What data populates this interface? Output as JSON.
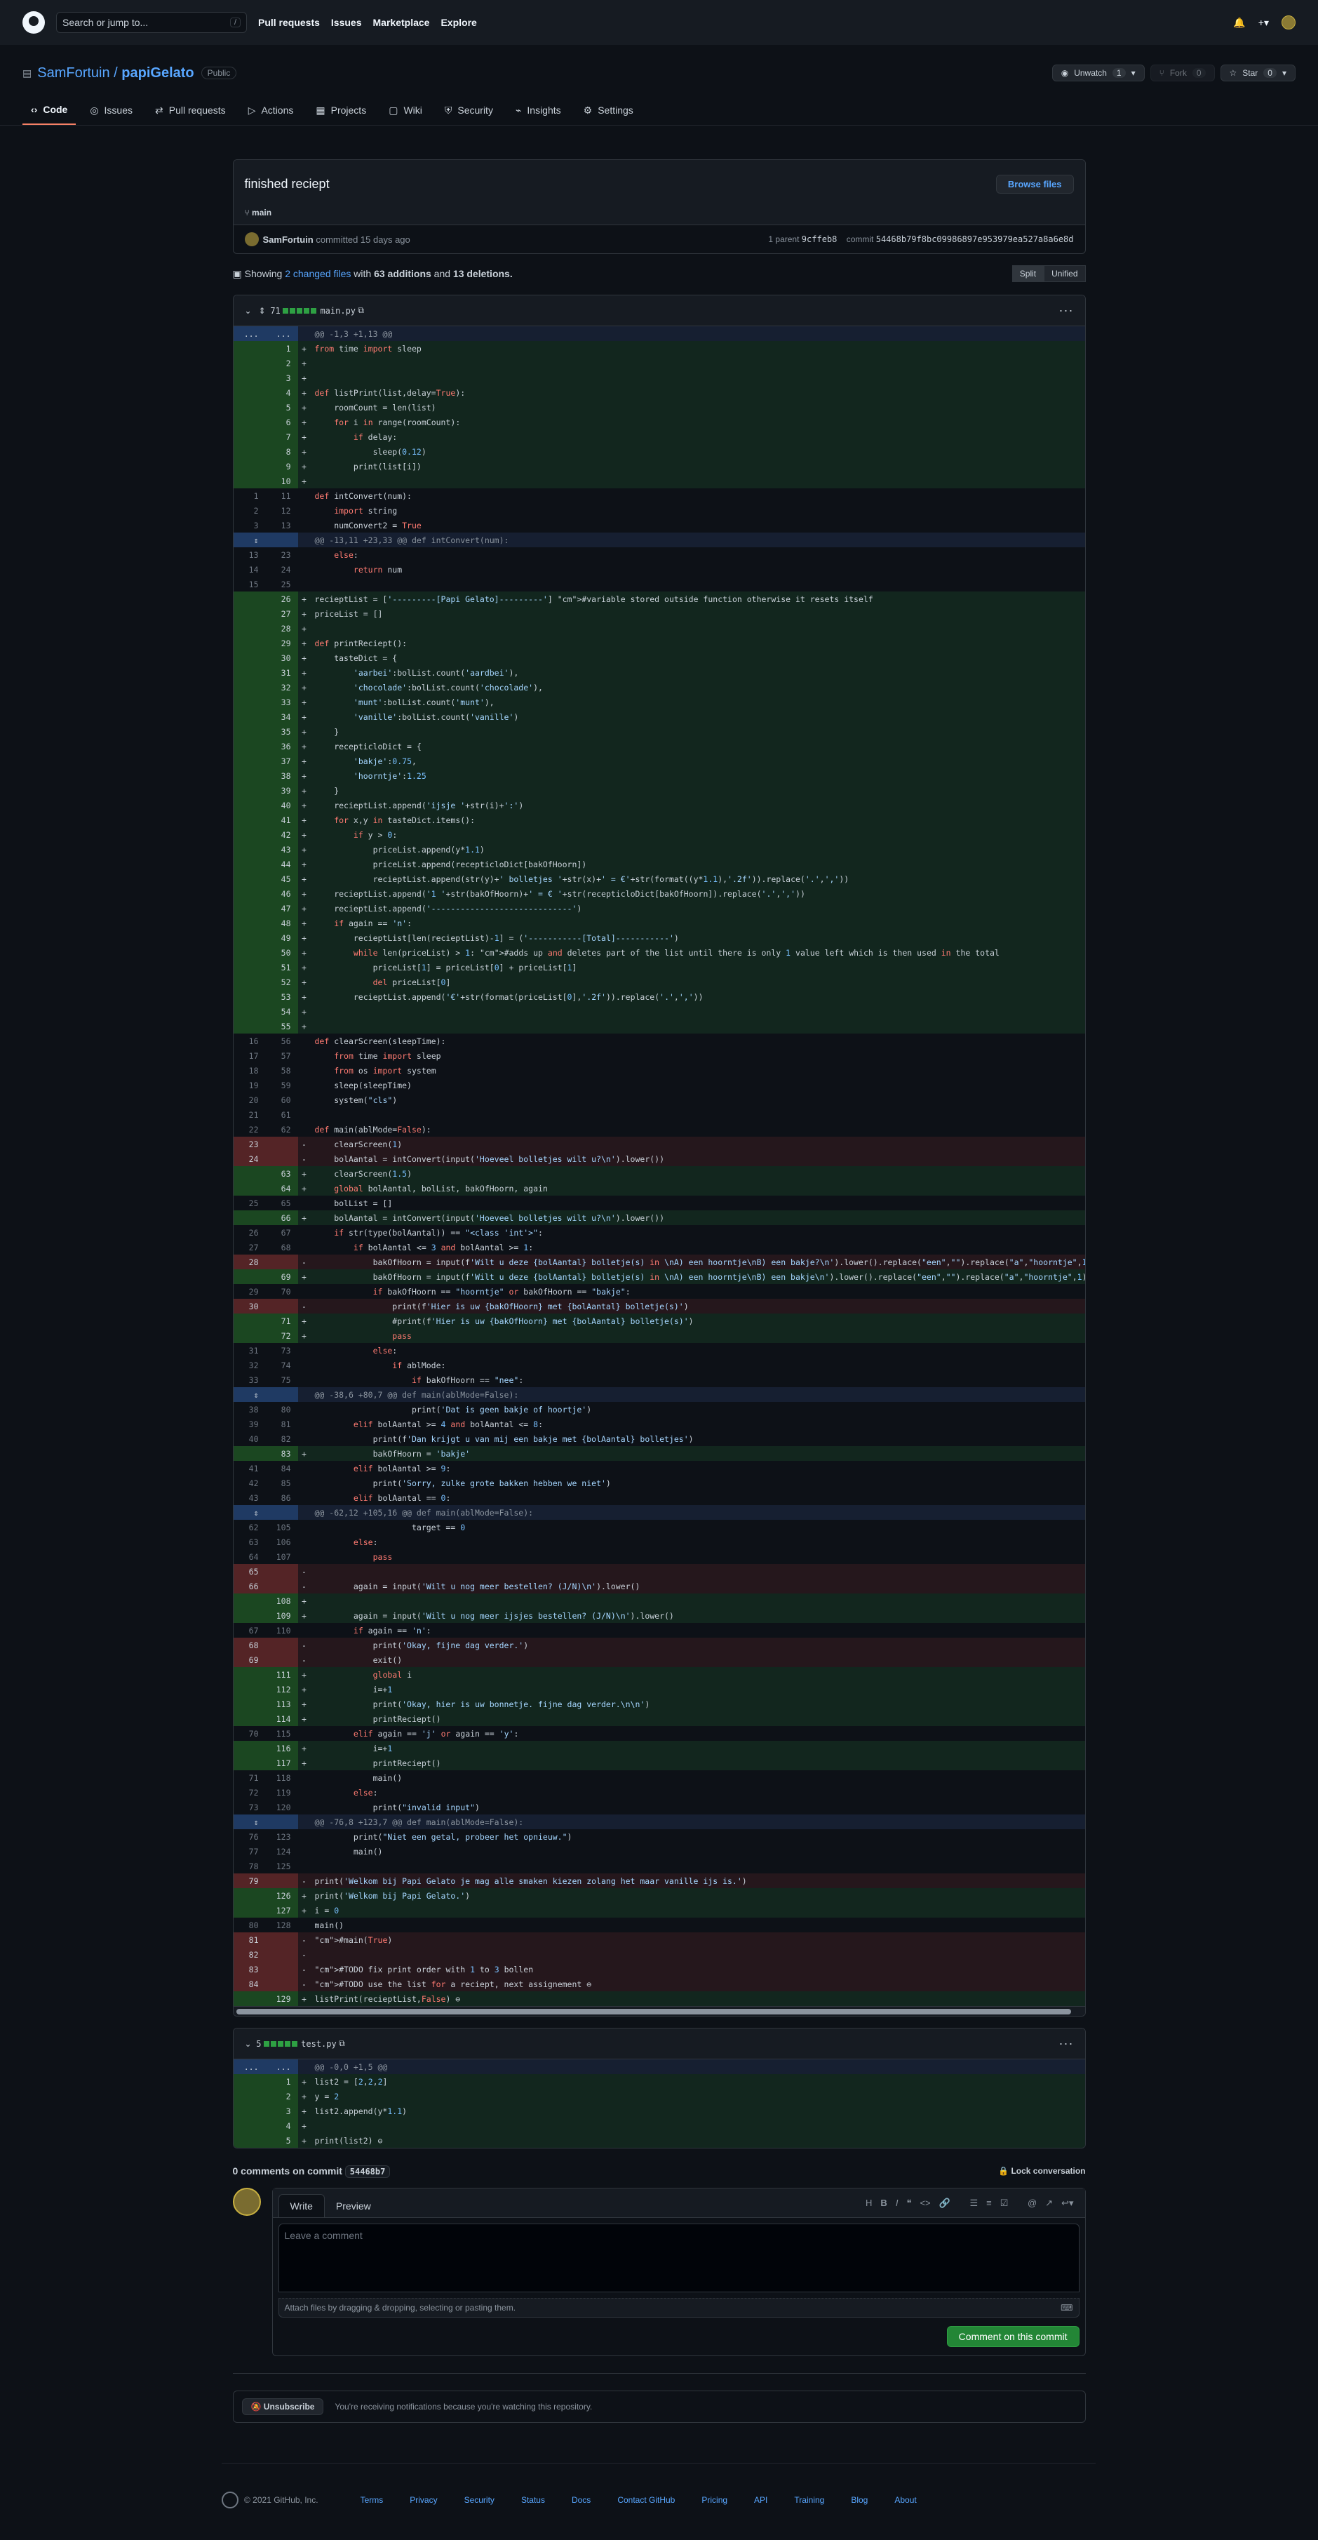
{
  "header": {
    "search_placeholder": "Search or jump to...",
    "slash": "/",
    "nav": [
      "Pull requests",
      "Issues",
      "Marketplace",
      "Explore"
    ]
  },
  "repo": {
    "owner": "SamFortuin",
    "name": "papiGelato",
    "visibility": "Public",
    "unwatch": "Unwatch",
    "unwatch_count": "1",
    "fork": "Fork",
    "fork_count": "0",
    "star": "Star",
    "star_count": "0"
  },
  "tabs": [
    "Code",
    "Issues",
    "Pull requests",
    "Actions",
    "Projects",
    "Wiki",
    "Security",
    "Insights",
    "Settings"
  ],
  "commit": {
    "title": "finished reciept",
    "browse": "Browse files",
    "branch": "main",
    "author": "SamFortuin",
    "time_text": "committed 15 days ago",
    "parent_label": "1 parent",
    "parent": "9cffeb8",
    "commit_label": "commit",
    "sha": "54468b79f8bc09986897e953979ea527a8a6e8d"
  },
  "summary": {
    "pre": "Showing",
    "files": "2 changed files",
    "mid": "with",
    "add": "63 additions",
    "and": "and",
    "del": "13 deletions.",
    "split": "Split",
    "unified": "Unified"
  },
  "file1": {
    "count": "71",
    "name": "main.py"
  },
  "file2": {
    "count": "5",
    "name": "test.py"
  },
  "diff1": [
    [
      "h",
      "...",
      "...",
      "@@ -1,3 +1,13 @@"
    ],
    [
      "a",
      "",
      "1",
      "from time import sleep"
    ],
    [
      "a",
      "",
      "2",
      ""
    ],
    [
      "a",
      "",
      "3",
      ""
    ],
    [
      "a",
      "",
      "4",
      "def listPrint(list,delay=True):"
    ],
    [
      "a",
      "",
      "5",
      "    roomCount = len(list)"
    ],
    [
      "a",
      "",
      "6",
      "    for i in range(roomCount):"
    ],
    [
      "a",
      "",
      "7",
      "        if delay:"
    ],
    [
      "a",
      "",
      "8",
      "            sleep(0.12)"
    ],
    [
      "a",
      "",
      "9",
      "        print(list[i])"
    ],
    [
      "a",
      "",
      "10",
      ""
    ],
    [
      "c",
      "1",
      "11",
      "def intConvert(num):"
    ],
    [
      "c",
      "2",
      "12",
      "    import string"
    ],
    [
      "c",
      "3",
      "13",
      "    numConvert2 = True"
    ],
    [
      "h",
      "",
      "",
      "@@ -13,11 +23,33 @@ def intConvert(num):"
    ],
    [
      "c",
      "13",
      "23",
      "    else:"
    ],
    [
      "c",
      "14",
      "24",
      "        return num"
    ],
    [
      "c",
      "15",
      "25",
      ""
    ],
    [
      "a",
      "",
      "26",
      "recieptList = ['---------[Papi Gelato]---------'] #variable stored outside function otherwise it resets itself"
    ],
    [
      "a",
      "",
      "27",
      "priceList = []"
    ],
    [
      "a",
      "",
      "28",
      ""
    ],
    [
      "a",
      "",
      "29",
      "def printReciept():"
    ],
    [
      "a",
      "",
      "30",
      "    tasteDict = {"
    ],
    [
      "a",
      "",
      "31",
      "        'aarbei':bolList.count('aardbei'),"
    ],
    [
      "a",
      "",
      "32",
      "        'chocolade':bolList.count('chocolade'),"
    ],
    [
      "a",
      "",
      "33",
      "        'munt':bolList.count('munt'),"
    ],
    [
      "a",
      "",
      "34",
      "        'vanille':bolList.count('vanille')"
    ],
    [
      "a",
      "",
      "35",
      "    }"
    ],
    [
      "a",
      "",
      "36",
      "    recepticloDict = {"
    ],
    [
      "a",
      "",
      "37",
      "        'bakje':0.75,"
    ],
    [
      "a",
      "",
      "38",
      "        'hoorntje':1.25"
    ],
    [
      "a",
      "",
      "39",
      "    }"
    ],
    [
      "a",
      "",
      "40",
      "    recieptList.append('ijsje '+str(i)+':')"
    ],
    [
      "a",
      "",
      "41",
      "    for x,y in tasteDict.items():"
    ],
    [
      "a",
      "",
      "42",
      "        if y > 0:"
    ],
    [
      "a",
      "",
      "43",
      "            priceList.append(y*1.1)"
    ],
    [
      "a",
      "",
      "44",
      "            priceList.append(recepticloDict[bakOfHoorn])"
    ],
    [
      "a",
      "",
      "45",
      "            recieptList.append(str(y)+' bolletjes '+str(x)+' = €'+str(format((y*1.1),'.2f')).replace('.',','))"
    ],
    [
      "a",
      "",
      "46",
      "    recieptList.append('1 '+str(bakOfHoorn)+' = € '+str(recepticloDict[bakOfHoorn]).replace('.',','))"
    ],
    [
      "a",
      "",
      "47",
      "    recieptList.append('-----------------------------')"
    ],
    [
      "a",
      "",
      "48",
      "    if again == 'n':"
    ],
    [
      "a",
      "",
      "49",
      "        recieptList[len(recieptList)-1] = ('-----------[Total]-----------')"
    ],
    [
      "a",
      "",
      "50",
      "        while len(priceList) > 1: #adds up and deletes part of the list until there is only 1 value left which is then used in the total"
    ],
    [
      "a",
      "",
      "51",
      "            priceList[1] = priceList[0] + priceList[1]"
    ],
    [
      "a",
      "",
      "52",
      "            del priceList[0]"
    ],
    [
      "a",
      "",
      "53",
      "        recieptList.append('€'+str(format(priceList[0],'.2f')).replace('.',','))"
    ],
    [
      "a",
      "",
      "54",
      ""
    ],
    [
      "a",
      "",
      "55",
      ""
    ],
    [
      "c",
      "16",
      "56",
      "def clearScreen(sleepTime):"
    ],
    [
      "c",
      "17",
      "57",
      "    from time import sleep"
    ],
    [
      "c",
      "18",
      "58",
      "    from os import system"
    ],
    [
      "c",
      "19",
      "59",
      "    sleep(sleepTime)"
    ],
    [
      "c",
      "20",
      "60",
      "    system(\"cls\")"
    ],
    [
      "c",
      "21",
      "61",
      ""
    ],
    [
      "c",
      "22",
      "62",
      "def main(ablMode=False):"
    ],
    [
      "d",
      "23",
      "",
      "    clearScreen(1)"
    ],
    [
      "d",
      "24",
      "",
      "    bolAantal = intConvert(input('Hoeveel bolletjes wilt u?\\n').lower())"
    ],
    [
      "a",
      "",
      "63",
      "    clearScreen(1.5)"
    ],
    [
      "a",
      "",
      "64",
      "    global bolAantal, bolList, bakOfHoorn, again"
    ],
    [
      "c",
      "25",
      "65",
      "    bolList = []"
    ],
    [
      "a",
      "",
      "66",
      "    bolAantal = intConvert(input('Hoeveel bolletjes wilt u?\\n').lower())"
    ],
    [
      "c",
      "26",
      "67",
      "    if str(type(bolAantal)) == \"<class 'int'>\":"
    ],
    [
      "c",
      "27",
      "68",
      "        if bolAantal <= 3 and bolAantal >= 1:"
    ],
    [
      "d",
      "28",
      "",
      "            bakOfHoorn = input(f'Wilt u deze {bolAantal} bolletje(s) in \\nA) een hoorntje\\nB) een bakje?\\n').lower().replace(\"een\",\"\").replace(\"a\",\"hoorntje\",1).repla"
    ],
    [
      "a",
      "",
      "69",
      "            bakOfHoorn = input(f'Wilt u deze {bolAantal} bolletje(s) in \\nA) een hoorntje\\nB) een bakje\\n').lower().replace(\"een\",\"\").replace(\"a\",\"hoorntje\",1).repla"
    ],
    [
      "c",
      "29",
      "70",
      "            if bakOfHoorn == \"hoorntje\" or bakOfHoorn == \"bakje\":"
    ],
    [
      "d",
      "30",
      "",
      "                print(f'Hier is uw {bakOfHoorn} met {bolAantal} bolletje(s)')"
    ],
    [
      "a",
      "",
      "71",
      "                #print(f'Hier is uw {bakOfHoorn} met {bolAantal} bolletje(s)')"
    ],
    [
      "a",
      "",
      "72",
      "                pass"
    ],
    [
      "c",
      "31",
      "73",
      "            else:"
    ],
    [
      "c",
      "32",
      "74",
      "                if ablMode:"
    ],
    [
      "c",
      "33",
      "75",
      "                    if bakOfHoorn == \"nee\":"
    ],
    [
      "h",
      "",
      "",
      "@@ -38,6 +80,7 @@ def main(ablMode=False):"
    ],
    [
      "c",
      "38",
      "80",
      "                    print('Dat is geen bakje of hoortje')"
    ],
    [
      "c",
      "39",
      "81",
      "        elif bolAantal >= 4 and bolAantal <= 8:"
    ],
    [
      "c",
      "40",
      "82",
      "            print(f'Dan krijgt u van mij een bakje met {bolAantal} bolletjes')"
    ],
    [
      "a",
      "",
      "83",
      "            bakOfHoorn = 'bakje'"
    ],
    [
      "c",
      "41",
      "84",
      "        elif bolAantal >= 9:"
    ],
    [
      "c",
      "42",
      "85",
      "            print('Sorry, zulke grote bakken hebben we niet')"
    ],
    [
      "c",
      "43",
      "86",
      "        elif bolAantal == 0:"
    ],
    [
      "h",
      "",
      "",
      "@@ -62,12 +105,16 @@ def main(ablMode=False):"
    ],
    [
      "c",
      "62",
      "105",
      "                    target == 0"
    ],
    [
      "c",
      "63",
      "106",
      "        else:"
    ],
    [
      "c",
      "64",
      "107",
      "            pass"
    ],
    [
      "d",
      "65",
      "",
      ""
    ],
    [
      "d",
      "66",
      "",
      "        again = input('Wilt u nog meer bestellen? (J/N)\\n').lower()"
    ],
    [
      "a",
      "",
      "108",
      ""
    ],
    [
      "a",
      "",
      "109",
      "        again = input('Wilt u nog meer ijsjes bestellen? (J/N)\\n').lower()"
    ],
    [
      "c",
      "67",
      "110",
      "        if again == 'n':"
    ],
    [
      "d",
      "68",
      "",
      "            print('Okay, fijne dag verder.')"
    ],
    [
      "d",
      "69",
      "",
      "            exit()"
    ],
    [
      "a",
      "",
      "111",
      "            global i"
    ],
    [
      "a",
      "",
      "112",
      "            i=+1"
    ],
    [
      "a",
      "",
      "113",
      "            print('Okay, hier is uw bonnetje. fijne dag verder.\\n\\n')"
    ],
    [
      "a",
      "",
      "114",
      "            printReciept()"
    ],
    [
      "c",
      "70",
      "115",
      "        elif again == 'j' or again == 'y':"
    ],
    [
      "a",
      "",
      "116",
      "            i=+1"
    ],
    [
      "a",
      "",
      "117",
      "            printReciept()"
    ],
    [
      "c",
      "71",
      "118",
      "            main()"
    ],
    [
      "c",
      "72",
      "119",
      "        else:"
    ],
    [
      "c",
      "73",
      "120",
      "            print(\"invalid input\")"
    ],
    [
      "h",
      "",
      "",
      "@@ -76,8 +123,7 @@ def main(ablMode=False):"
    ],
    [
      "c",
      "76",
      "123",
      "        print(\"Niet een getal, probeer het opnieuw.\")"
    ],
    [
      "c",
      "77",
      "124",
      "        main()"
    ],
    [
      "c",
      "78",
      "125",
      ""
    ],
    [
      "d",
      "79",
      "",
      "print('Welkom bij Papi Gelato je mag alle smaken kiezen zolang het maar vanille ijs is.')"
    ],
    [
      "a",
      "",
      "126",
      "print('Welkom bij Papi Gelato.')"
    ],
    [
      "a",
      "",
      "127",
      "i = 0"
    ],
    [
      "c",
      "80",
      "128",
      "main()"
    ],
    [
      "d",
      "81",
      "",
      "#main(True)"
    ],
    [
      "d",
      "82",
      "",
      ""
    ],
    [
      "d",
      "83",
      "",
      "#TODO fix print order with 1 to 3 bollen"
    ],
    [
      "d",
      "84",
      "",
      "#TODO use the list for a reciept, next assignement ⊖"
    ],
    [
      "a",
      "",
      "129",
      "listPrint(recieptList,False) ⊖"
    ]
  ],
  "diff2": [
    [
      "h",
      "...",
      "...",
      "@@ -0,0 +1,5 @@"
    ],
    [
      "a",
      "",
      "1",
      "list2 = [2,2,2]"
    ],
    [
      "a",
      "",
      "2",
      "y = 2"
    ],
    [
      "a",
      "",
      "3",
      "list2.append(y*1.1)"
    ],
    [
      "a",
      "",
      "4",
      ""
    ],
    [
      "a",
      "",
      "5",
      "print(list2) ⊖"
    ]
  ],
  "comments": {
    "title_pre": "0 comments on commit",
    "sha": "54468b7",
    "lock": "Lock conversation",
    "write": "Write",
    "preview": "Preview",
    "placeholder": "Leave a comment",
    "attach": "Attach files by dragging & dropping, selecting or pasting them.",
    "submit": "Comment on this commit",
    "unsubscribe": "Unsubscribe",
    "notif": "You're receiving notifications because you're watching this repository."
  },
  "footer": {
    "copyright": "© 2021 GitHub, Inc.",
    "links": [
      "Terms",
      "Privacy",
      "Security",
      "Status",
      "Docs",
      "Contact GitHub",
      "Pricing",
      "API",
      "Training",
      "Blog",
      "About"
    ]
  }
}
